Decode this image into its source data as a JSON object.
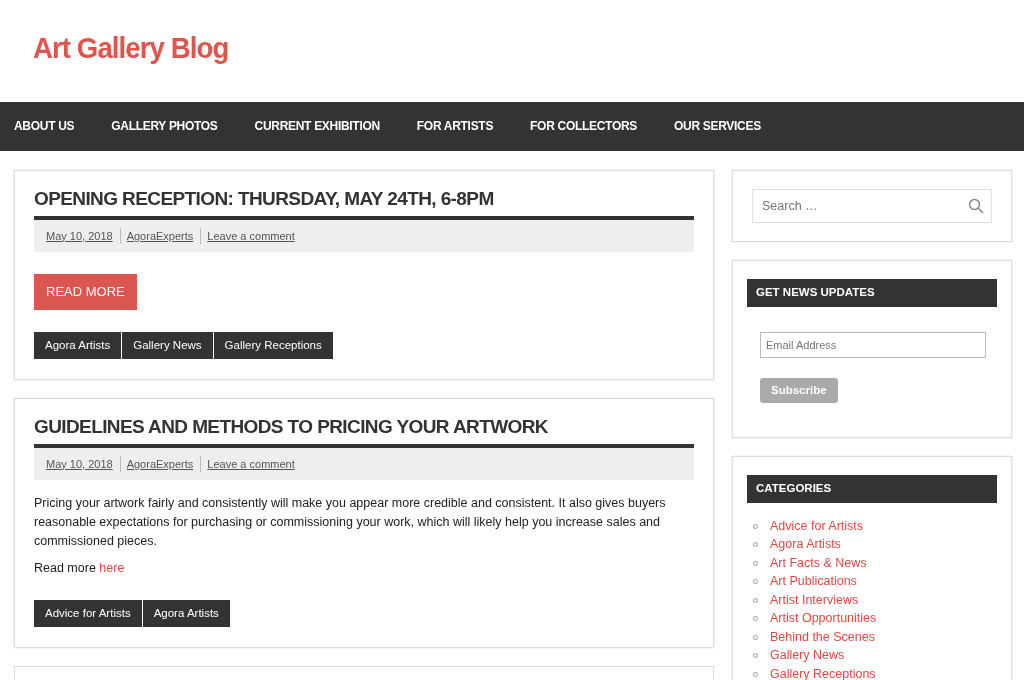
{
  "site_title": "Art Gallery Blog",
  "nav": [
    "ABOUT US",
    "GALLERY PHOTOS",
    "CURRENT EXHIBITION",
    "FOR ARTISTS",
    "FOR COLLECTORS",
    "OUR SERVICES"
  ],
  "posts": [
    {
      "title": "OPENING RECEPTION: THURSDAY, MAY 24TH, 6-8PM",
      "meta": [
        "May 10, 2018",
        "AgoraExperts",
        "Leave a comment"
      ],
      "button": "READ MORE",
      "tags": [
        "Agora Artists",
        "Gallery News",
        "Gallery Receptions"
      ]
    },
    {
      "title": "GUIDELINES AND METHODS TO PRICING YOUR ARTWORK",
      "meta": [
        "May 10, 2018",
        "AgoraExperts",
        "Leave a comment"
      ],
      "excerpt": "Pricing your artwork fairly and consistently will make you appear more credible and consistent. It also gives buyers reasonable expectations for purchasing or commissioning your work, which will likely help you increase sales and commissioned pieces.",
      "read_more": "Read more",
      "read_more_link": "here",
      "tags": [
        "Advice for Artists",
        "Agora Artists"
      ]
    }
  ],
  "sidebar": {
    "search": {
      "placeholder": "Search …"
    },
    "newsletter": {
      "title": "GET NEWS UPDATES",
      "email_placeholder": "Email Address",
      "button": "Subscribe"
    },
    "categories": {
      "title": "CATEGORIES",
      "items": [
        "Advice for Artists",
        "Agora Artists",
        "Art Facts & News",
        "Art Publications",
        "Artist Interviews",
        "Artist Opportunities",
        "Behind the Scenes",
        "Gallery News",
        "Gallery Receptions"
      ]
    }
  }
}
